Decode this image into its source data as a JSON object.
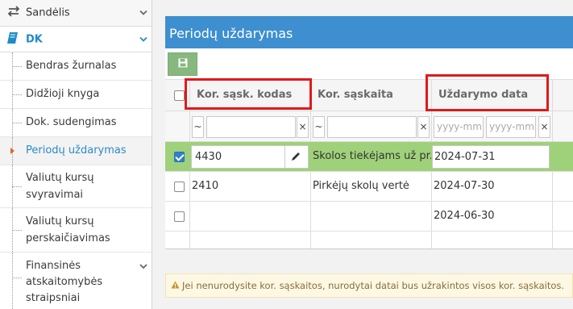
{
  "sidebar": {
    "sandelis_label": "Sandėlis",
    "dk_label": "DK",
    "items": [
      {
        "label": "Bendras žurnalas"
      },
      {
        "label": "Didžioji knyga"
      },
      {
        "label": "Dok. sudengimas"
      },
      {
        "label": "Periodų uždarymas",
        "active": true
      },
      {
        "label_lines": [
          "Valiutų kursų",
          "svyravimai"
        ]
      },
      {
        "label_lines": [
          "Valiutų kursų",
          "perskaičiavimas"
        ]
      },
      {
        "label_lines": [
          "Finansinės",
          "atskaitomybės",
          "straipsniai"
        ]
      }
    ]
  },
  "panel": {
    "title": "Periodų uždarymas",
    "save_icon": "floppy-disk-icon"
  },
  "grid": {
    "columns": [
      "Kor. sąsk. kodas",
      "Kor. sąskaita",
      "Uždarymo data"
    ],
    "filters": {
      "op1": "~",
      "clear1": "×",
      "op2": "~",
      "clear2": "×",
      "date_from_placeholder": "yyyy-mm",
      "date_to_placeholder": "yyyy-mm",
      "clear3": "×"
    },
    "rows": [
      {
        "code": "4430",
        "account": "Skolos tiekėjams už pr...",
        "date": "2024-07-31",
        "checked": true,
        "selected": true
      },
      {
        "code": "2410",
        "account": "Pirkėjų skolų vertė",
        "date": "2024-07-30",
        "checked": false
      },
      {
        "code": "",
        "account": "",
        "date": "2024-06-30",
        "checked": false
      }
    ]
  },
  "notice": {
    "text": "Jei nenurodysite kor. sąskaitos, nurodytai datai bus užrakintos visos kor. sąskaitos."
  },
  "colors": {
    "title_bar": "#3d8fd0",
    "selected_row": "#9fd17a",
    "highlight_box": "#e01a1a",
    "active_link": "#2b8ac6"
  }
}
